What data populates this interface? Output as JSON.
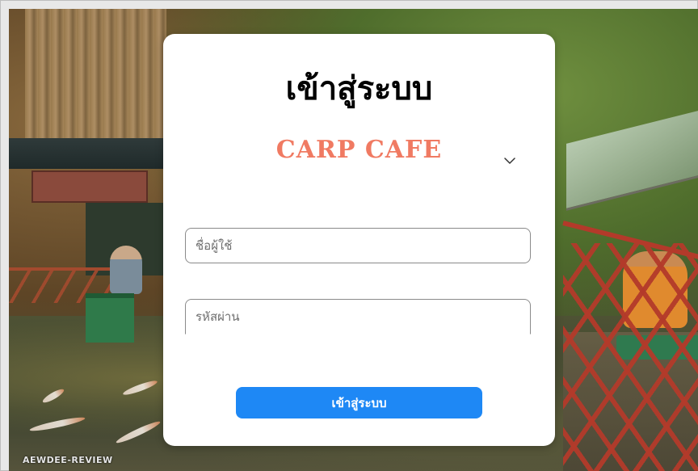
{
  "login": {
    "title": "เข้าสู่ระบบ",
    "brand": "CARP CAFE",
    "username_placeholder": "ชื่อผู้ใช้",
    "password_placeholder": "รหัสผ่าน",
    "submit_label": "เข้าสู่ระบบ",
    "dropdown_icon": "chevron-down-icon"
  },
  "background": {
    "watermark": "AEWDEE-REVIEW"
  },
  "colors": {
    "brand": "#f07a62",
    "button": "#1e88f5",
    "card": "#ffffff"
  }
}
